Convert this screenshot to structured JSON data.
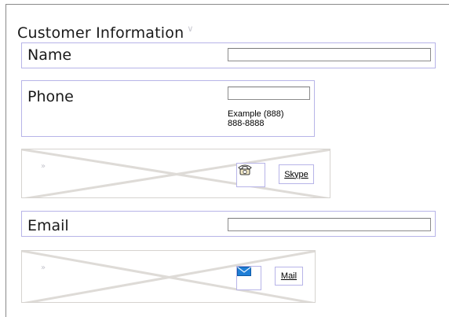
{
  "section": {
    "title": "Customer Information"
  },
  "name_field": {
    "label": "Name",
    "value": ""
  },
  "phone_field": {
    "label": "Phone",
    "value": "",
    "hint": "Example (888) 888-8888"
  },
  "skype_widget": {
    "button_label": "Skype",
    "icon": "telephone-icon"
  },
  "email_field": {
    "label": "Email",
    "value": ""
  },
  "mail_widget": {
    "button_label": "Mail",
    "icon": "envelope-icon"
  }
}
